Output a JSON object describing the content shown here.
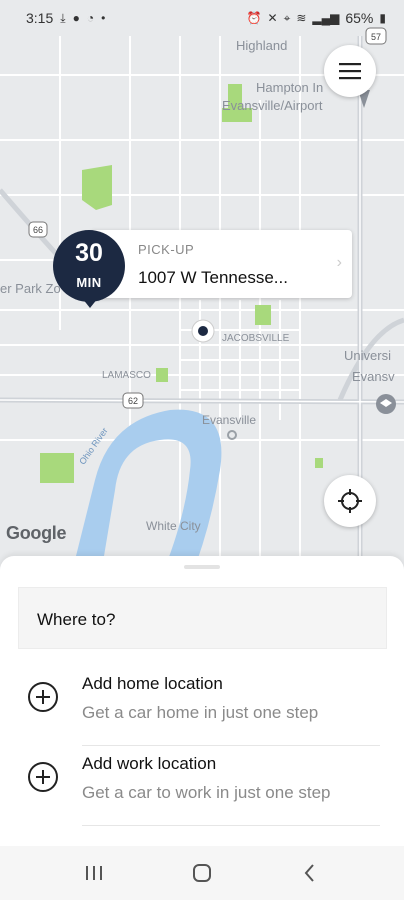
{
  "status_bar": {
    "time": "3:15",
    "left_icons": [
      "download-icon",
      "facebook-icon",
      "messenger-icon",
      "dot-icon"
    ],
    "right_icons": [
      "alarm-icon",
      "mute-icon",
      "location-icon",
      "wifi-icon",
      "signal-icon"
    ],
    "battery": "65%"
  },
  "map": {
    "labels": {
      "highland": "Highland",
      "hampton": "Hampton In",
      "airport": "Evansville/Airport",
      "park_zoo": "er Park Zo",
      "jacobsville": "JACOBSVILLE",
      "lamasco": "LAMASCO",
      "university": "Universi",
      "evans": "Evansv",
      "evansville": "Evansville",
      "ohio_river": "Ohio River",
      "white_city": "White City",
      "route_57": "57",
      "route_66": "66",
      "route_62": "62"
    },
    "google_logo": "Google"
  },
  "pickup": {
    "eta_value": "30",
    "eta_unit": "MIN",
    "label": "PICK-UP",
    "address": "1007 W Tennesse..."
  },
  "sheet": {
    "search_placeholder": "Where to?",
    "options": [
      {
        "title": "Add home location",
        "subtitle": "Get a car home in just one step"
      },
      {
        "title": "Add work location",
        "subtitle": "Get a car to work in just one step"
      }
    ]
  },
  "colors": {
    "eta_bubble": "#1c2942",
    "water": "#a9cdee",
    "park": "#a8d97c",
    "map_bg": "#e8eaec"
  }
}
